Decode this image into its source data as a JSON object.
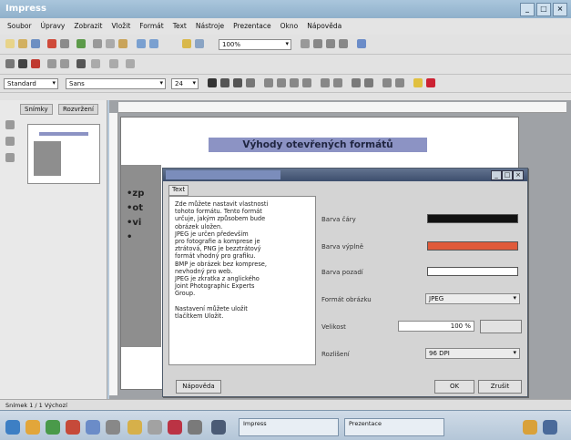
{
  "window": {
    "title": "Impress"
  },
  "menu": [
    "Soubor",
    "Úpravy",
    "Zobrazit",
    "Vložit",
    "Formát",
    "Text",
    "Nástroje",
    "Prezentace",
    "Okno",
    "Nápověda"
  ],
  "toolbar": {
    "zoom": "100%"
  },
  "format_toolbar": {
    "style_name": "Standard",
    "font_name": "Sans",
    "font_size": "24"
  },
  "panel": {
    "tabs": [
      "Snímky",
      "Rozvržení"
    ]
  },
  "slide": {
    "title": "Výhody otevřených formátů",
    "bullets": [
      "•zp",
      "•ot",
      "•vi",
      "•"
    ]
  },
  "dialog": {
    "tab": "Text",
    "text_lines": [
      "Zde můžete nastavit vlastnosti",
      "tohoto formátu. Tento formát",
      "určuje, jakým způsobem bude",
      "obrázek uložen.",
      "JPEG je určen především",
      "pro fotografie a komprese je",
      "ztrátová, PNG je bezztrátový",
      "formát vhodný pro grafiku.",
      "BMP je obrázek bez komprese,",
      "nevhodný pro web.",
      "JPEG je zkratka z anglického",
      "Joint Photographic Experts",
      "Group.",
      "",
      "Nastavení můžete uložit",
      "tlačítkem Uložit."
    ],
    "fields": {
      "line_color_label": "Barva čáry",
      "fill_color_label": "Barva výplně",
      "bg_color_label": "Barva pozadí",
      "format_label": "Formát obrázku",
      "format_value": "JPEG",
      "size_label": "Velikost",
      "size_value": "100 %",
      "mode_label": "Rozlišení",
      "mode_value": "96 DPI"
    },
    "colors": {
      "line": "#111111",
      "fill": "#e05a3a",
      "background": "#ffffff"
    },
    "buttons": {
      "help": "Nápověda",
      "ok": "OK",
      "cancel": "Zrušit"
    }
  },
  "statusbar": {
    "text": "Snímek 1 / 1   Výchozí"
  },
  "taskbar": {
    "windows": [
      "Impress",
      "Prezentace"
    ]
  }
}
